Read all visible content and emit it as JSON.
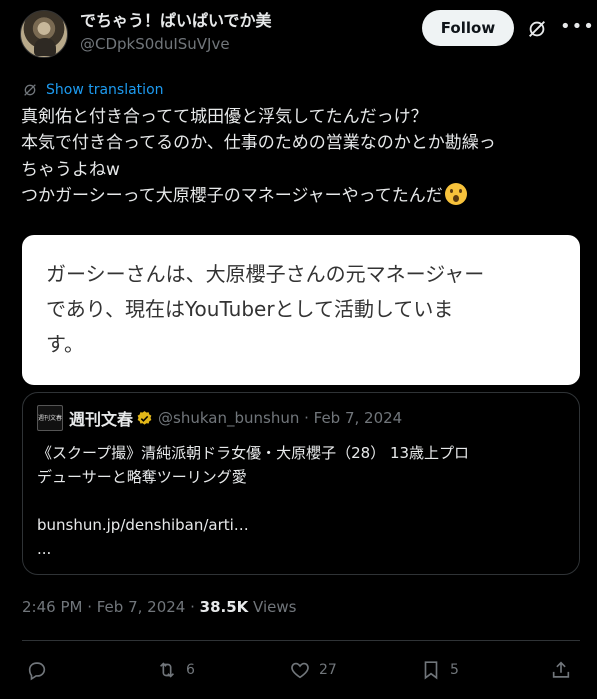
{
  "author": {
    "display_name": "でちゃう！ぱいぱいでか美",
    "handle": "@CDpkS0duISuVJve",
    "follow_label": "Follow"
  },
  "translation_label": "Show translation",
  "tweet_lines": [
    "真剣佑と付き合ってて城田優と浮気してたんだっけ？",
    "本気で付き合ってるのか、仕事のための営業なのかとか勘繰っ",
    "ちゃうよねw",
    "つかガーシーって大原櫻子のマネージャーやってたんだ"
  ],
  "emoji_name": "astonished-face",
  "note_lines": [
    "ガーシーさんは、大原櫻子さんの元マネージャー",
    "であり、現在はYouTuberとして活動していま",
    "す。"
  ],
  "quote": {
    "logo_text": "週刊文春",
    "name": "週刊文春",
    "handle_date": "@shukan_bunshun · Feb 7, 2024",
    "lines": [
      "《スクープ撮》清純派朝ドラ女優・大原櫻子（28） 13歳上プロ",
      "デューサーと略奪ツーリング愛",
      "",
      "bunshun.jp/denshiban/arti…",
      "..."
    ]
  },
  "meta": {
    "time_date": "2:46 PM · Feb 7, 2024 · ",
    "views_count": "38.5K",
    "views_label": " Views"
  },
  "actions": {
    "replies": "",
    "reposts": "6",
    "likes": "27",
    "bookmarks": "5"
  },
  "colors": {
    "background": "#000000",
    "link": "#1d9bf0",
    "muted": "#71767b",
    "verified": "#e2b719"
  }
}
